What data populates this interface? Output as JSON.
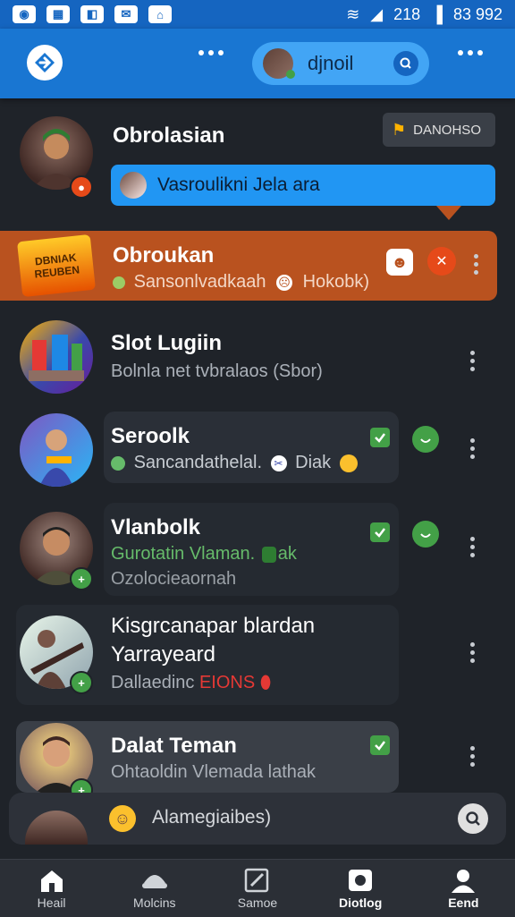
{
  "status_bar": {
    "left_icons": [
      "status-icon-1",
      "status-icon-2",
      "status-icon-3",
      "status-icon-4",
      "status-icon-5"
    ],
    "network_label": "218",
    "battery_label": "▐",
    "time": "83 992"
  },
  "app_bar": {
    "search_label": "djnoil"
  },
  "header_row": {
    "name": "Obrolasian",
    "button_label": "DANOHSO",
    "bubble_text": "Vasroulikni Jela ara"
  },
  "chats": [
    {
      "id": "obroukan",
      "name": "Obroukan",
      "message": "Sansonlvadkaah",
      "suffix": "Hokobk)",
      "banner_text": "DBNIAK REUBEN"
    },
    {
      "id": "slot",
      "name": "Slot Lugiin",
      "message": "Bolnla net tvbralaos (Sbor)"
    },
    {
      "id": "seroolk",
      "name": "Seroolk",
      "message": "Sancandathelal.",
      "suffix": "Diak"
    },
    {
      "id": "vlanbolk",
      "name": "Vlanbolk",
      "message": "Gurotatin Vlaman.",
      "message_tail": "ak",
      "extra": "Ozolocieaornah"
    },
    {
      "id": "kisgr",
      "name": "Kisgrcanapar blardan",
      "name2": "Yarrayeard",
      "message": "Dallaedinc",
      "highlight": "EIONS"
    },
    {
      "id": "dalat",
      "name": "Dalat Teman",
      "message": "Ohtaoldin Vlemada lathak"
    }
  ],
  "compose": {
    "placeholder": "Alamegiaibes)"
  },
  "bottom_nav": [
    {
      "label": "Heail",
      "icon": "home-icon"
    },
    {
      "label": "Molcins",
      "icon": "hat-icon"
    },
    {
      "label": "Samoe",
      "icon": "edit-icon"
    },
    {
      "label": "Diotlog",
      "icon": "dialog-icon"
    },
    {
      "label": "Eend",
      "icon": "person-icon"
    }
  ],
  "colors": {
    "accent": "#1976d2",
    "highlight_row": "#b9521f",
    "online": "#43a047",
    "background": "#1f2329"
  }
}
